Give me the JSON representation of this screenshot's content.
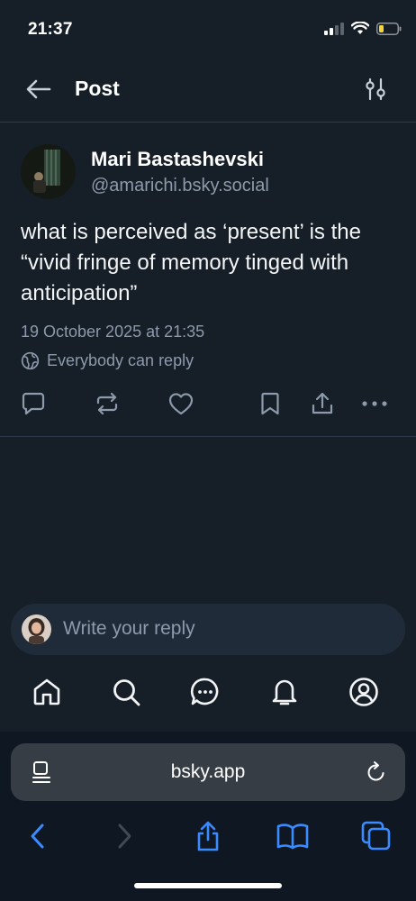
{
  "status": {
    "time": "21:37"
  },
  "header": {
    "title": "Post"
  },
  "post": {
    "author_name": "Mari Bastashevski",
    "author_handle": "@amarichi.bsky.social",
    "text": "what is perceived as ‘present’ is the “vivid fringe of memory tinged with anticipation”",
    "date": "19 October 2025 at 21:35",
    "reply_setting": "Everybody can reply"
  },
  "reply": {
    "placeholder": "Write your reply"
  },
  "browser": {
    "url": "bsky.app"
  },
  "colors": {
    "accent": "#3a8bff",
    "muted": "#8d9aab",
    "background": "#161e27"
  }
}
